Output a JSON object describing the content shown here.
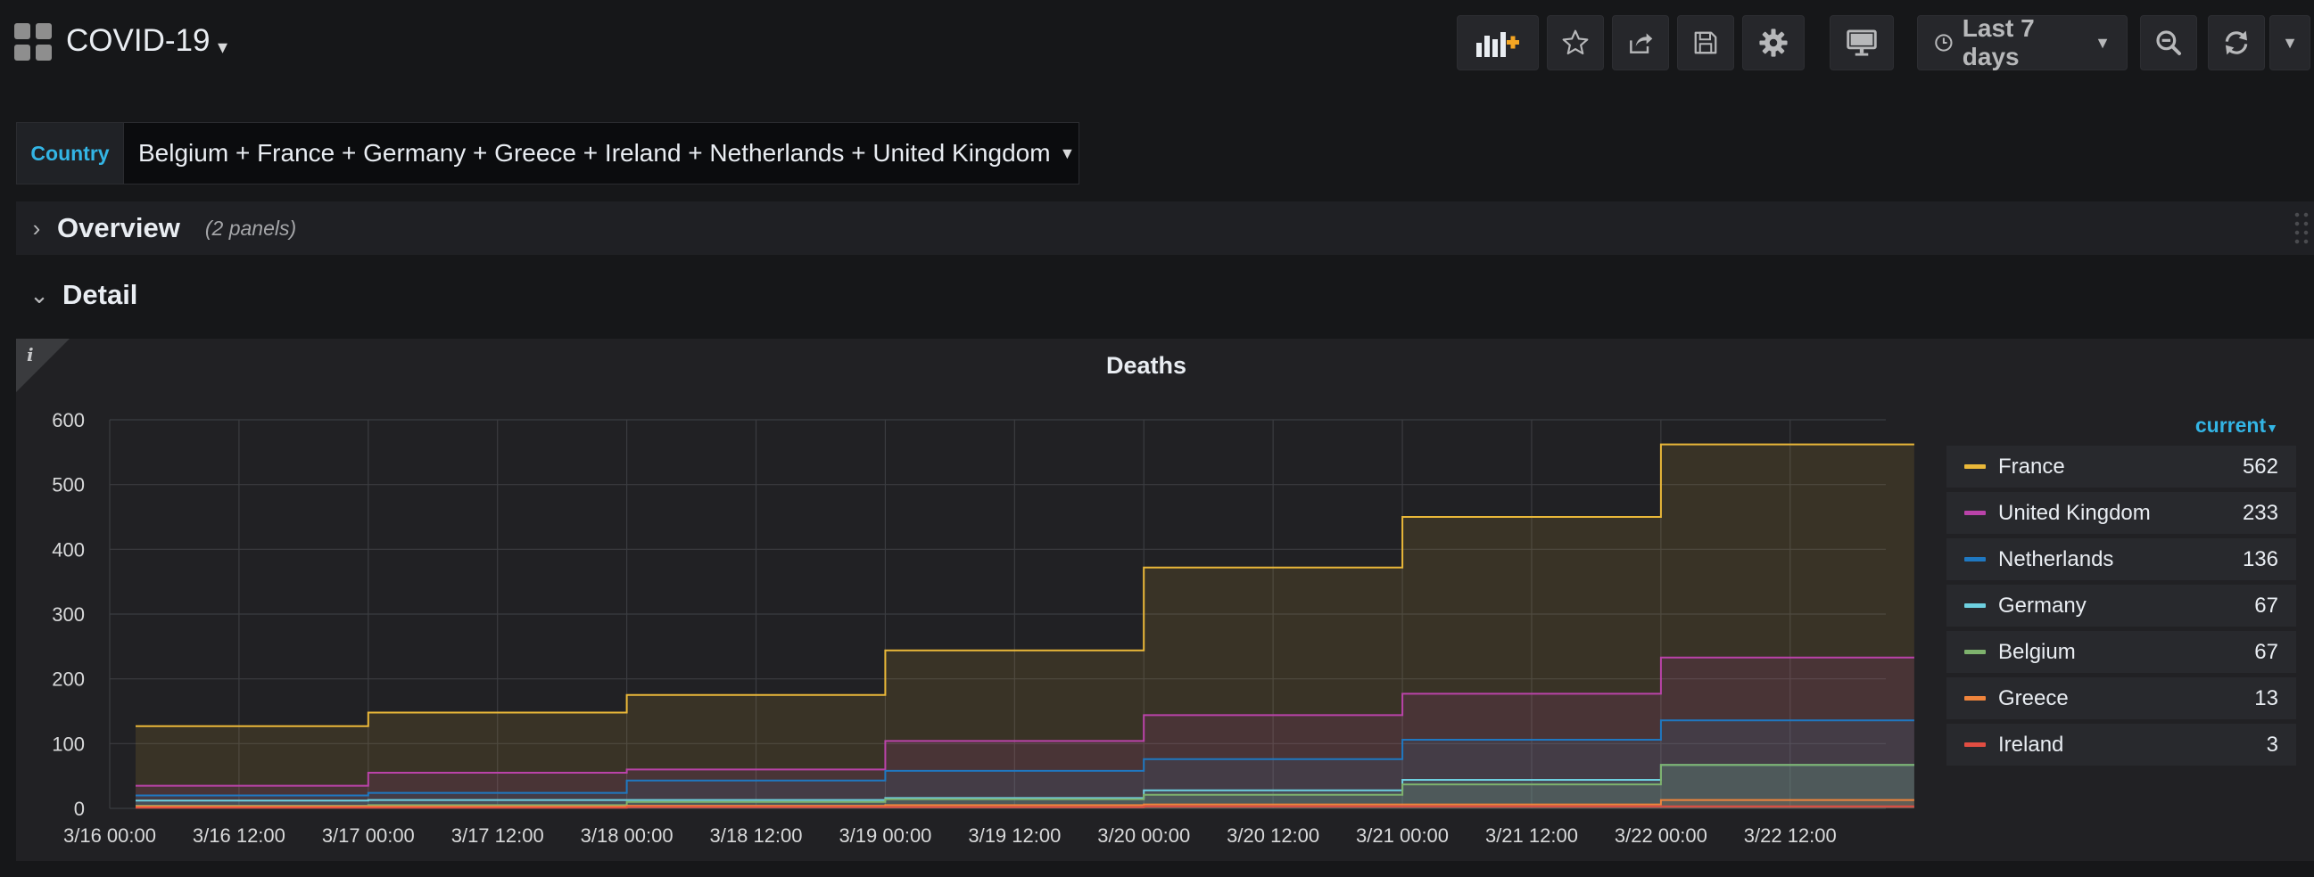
{
  "dashboard": {
    "title": "COVID-19"
  },
  "toolbar": {
    "time_range": "Last 7 days"
  },
  "variable": {
    "label": "Country",
    "value": "Belgium + France + Germany + Greece + Ireland + Netherlands + United Kingdom"
  },
  "rows": {
    "overview": {
      "title": "Overview",
      "count": "(2 panels)"
    },
    "detail": {
      "title": "Detail"
    }
  },
  "panel": {
    "title": "Deaths",
    "info_icon": "i",
    "legend_header": "current",
    "legend": [
      {
        "name": "France",
        "value": "562",
        "color": "#EAB839"
      },
      {
        "name": "United Kingdom",
        "value": "233",
        "color": "#BA43A9"
      },
      {
        "name": "Netherlands",
        "value": "136",
        "color": "#1F78C1"
      },
      {
        "name": "Germany",
        "value": "67",
        "color": "#6ED0E0"
      },
      {
        "name": "Belgium",
        "value": "67",
        "color": "#7EB26D"
      },
      {
        "name": "Greece",
        "value": "13",
        "color": "#EF843C"
      },
      {
        "name": "Ireland",
        "value": "3",
        "color": "#E24D42"
      }
    ]
  },
  "chart_data": {
    "type": "area",
    "title": "Deaths",
    "x_tick_labels": [
      "3/16 00:00",
      "3/16 12:00",
      "3/17 00:00",
      "3/17 12:00",
      "3/18 00:00",
      "3/18 12:00",
      "3/19 00:00",
      "3/19 12:00",
      "3/20 00:00",
      "3/20 12:00",
      "3/21 00:00",
      "3/21 12:00",
      "3/22 00:00",
      "3/22 12:00"
    ],
    "y_ticks": [
      0,
      100,
      200,
      300,
      400,
      500,
      600
    ],
    "ylim": [
      0,
      600
    ],
    "xlim_days": [
      0,
      6.98
    ],
    "step_days": [
      0.1,
      1,
      2,
      3,
      4,
      5,
      6
    ],
    "series_end_day": 6.98,
    "grid": true,
    "legend_position": "right",
    "series": [
      {
        "name": "France",
        "color": "#EAB839",
        "values": [
          127,
          148,
          175,
          244,
          372,
          450,
          562
        ]
      },
      {
        "name": "United Kingdom",
        "color": "#BA43A9",
        "values": [
          35,
          55,
          60,
          104,
          144,
          177,
          233
        ]
      },
      {
        "name": "Netherlands",
        "color": "#1F78C1",
        "values": [
          20,
          24,
          43,
          58,
          76,
          106,
          136
        ]
      },
      {
        "name": "Germany",
        "color": "#6ED0E0",
        "values": [
          12,
          13,
          13,
          16,
          28,
          44,
          67
        ]
      },
      {
        "name": "Belgium",
        "color": "#7EB26D",
        "values": [
          4,
          5,
          10,
          14,
          21,
          37,
          67
        ]
      },
      {
        "name": "Greece",
        "color": "#EF843C",
        "values": [
          3,
          3,
          4,
          5,
          6,
          6,
          13
        ]
      },
      {
        "name": "Ireland",
        "color": "#E24D42",
        "values": [
          1,
          1,
          2,
          2,
          3,
          3,
          3
        ]
      }
    ]
  }
}
